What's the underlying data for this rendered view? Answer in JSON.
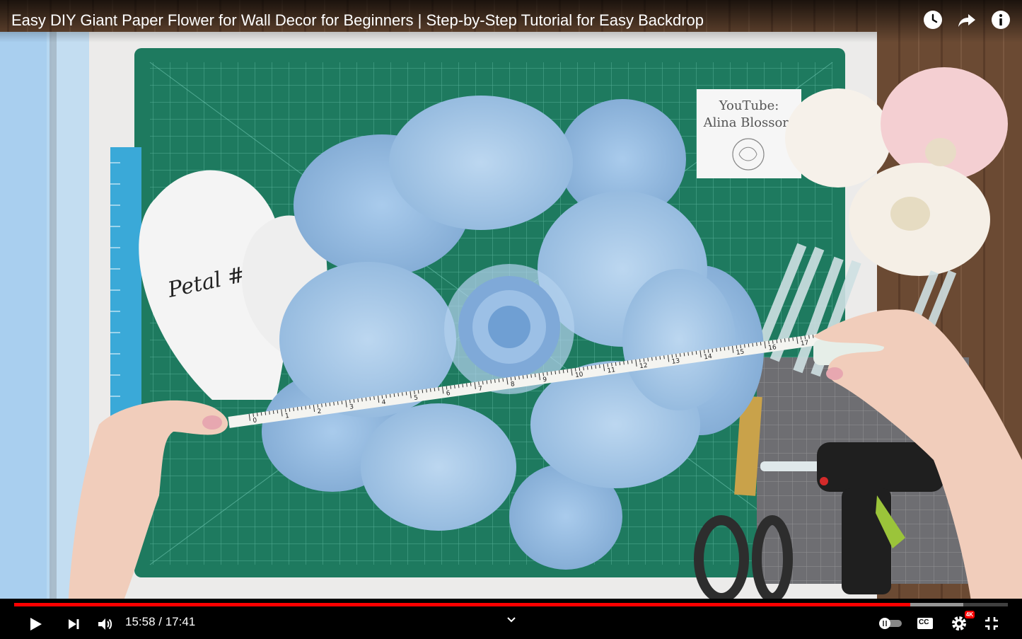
{
  "video": {
    "title": "Easy DIY Giant Paper Flower for Wall Decor for Beginners | Step-by-Step Tutorial for Easy Backdrop",
    "current_time": "15:58",
    "duration": "17:41",
    "time_display": "15:58 / 17:41",
    "progress_played": 0.902,
    "progress_buffered": 0.955
  },
  "scene": {
    "sign_line1": "YouTube:",
    "sign_line2": "Alina Blossom",
    "template_label": "Petal #",
    "tape_numbers": [
      "0",
      "1",
      "2",
      "3",
      "4",
      "5",
      "6",
      "7",
      "8",
      "9",
      "10",
      "11",
      "12",
      "13",
      "14",
      "15",
      "16",
      "17"
    ]
  },
  "controls": {
    "quality_badge": "4K",
    "cc_label": "CC"
  }
}
